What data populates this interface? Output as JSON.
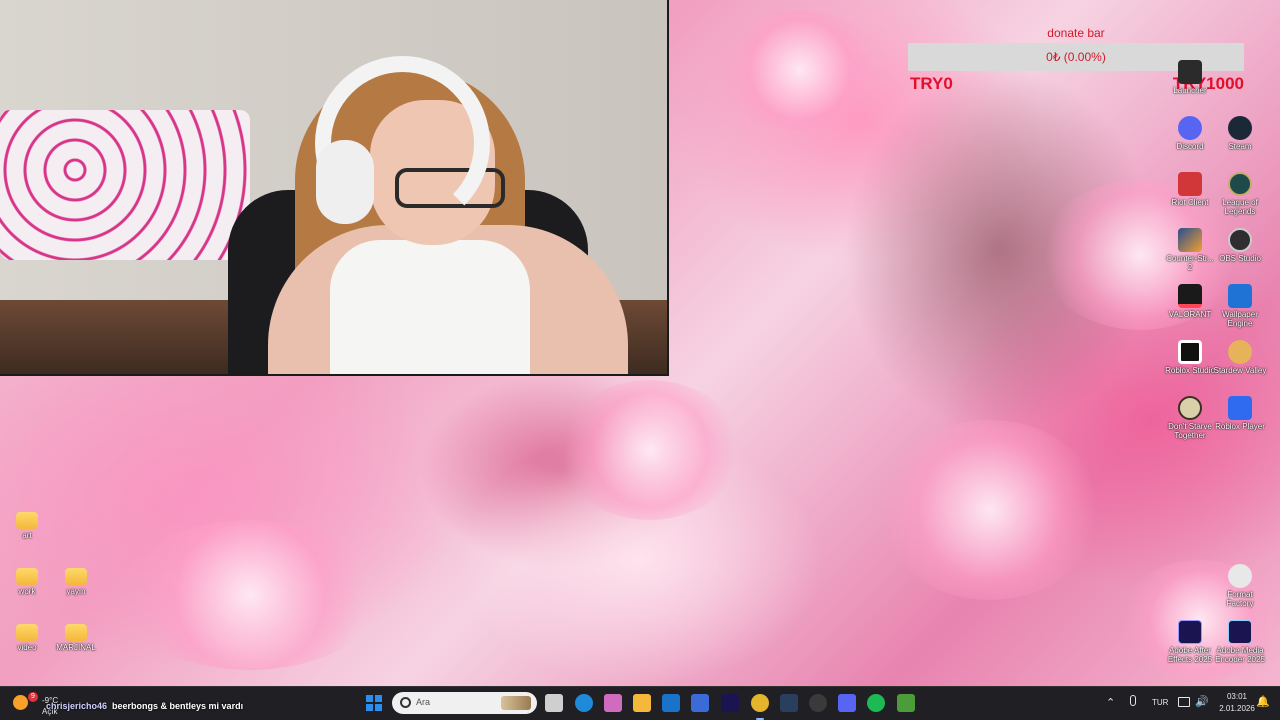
{
  "donate_bar": {
    "title": "donate bar",
    "value_text": "0₺ (0.00%)",
    "progress_fraction": 0.0,
    "min_label": "TRY0",
    "max_label": "TRY1000",
    "accent_color": "#d11a2a"
  },
  "desktop_left": {
    "items": [
      {
        "label": "art",
        "icon": "folder-icon"
      },
      {
        "label": "work",
        "icon": "folder-icon"
      },
      {
        "label": "yayın",
        "icon": "folder-icon"
      },
      {
        "label": "video",
        "icon": "folder-icon"
      },
      {
        "label": "MARJINAL",
        "icon": "folder-icon"
      }
    ]
  },
  "desktop_right": {
    "items": [
      {
        "label": "Launcher",
        "icon": "launcher-icon"
      },
      {
        "label": "Discord",
        "icon": "discord-icon"
      },
      {
        "label": "Steam",
        "icon": "steam-icon"
      },
      {
        "label": "Riot Client",
        "icon": "riot-client-icon"
      },
      {
        "label": "League of Legends",
        "icon": "league-of-legends-icon"
      },
      {
        "label": "Counter-Str... 2",
        "icon": "counter-strike-icon"
      },
      {
        "label": "OBS Studio",
        "icon": "obs-studio-icon"
      },
      {
        "label": "VALORANT",
        "icon": "valorant-icon"
      },
      {
        "label": "Wallpaper Engine",
        "icon": "wallpaper-engine-icon"
      },
      {
        "label": "Roblox Studio",
        "icon": "roblox-studio-icon"
      },
      {
        "label": "Stardew Valley",
        "icon": "stardew-valley-icon"
      },
      {
        "label": "Don't Starve Together",
        "icon": "dont-starve-icon"
      },
      {
        "label": "Roblox Player",
        "icon": "roblox-player-icon"
      },
      {
        "label": "Format Factory",
        "icon": "format-factory-icon"
      },
      {
        "label": "Adobe After Effects 2025",
        "icon": "after-effects-icon"
      },
      {
        "label": "Adobe Media Encoder 2025",
        "icon": "media-encoder-icon"
      }
    ]
  },
  "taskbar": {
    "weather": {
      "temp": "-9°C",
      "desc": "Açık",
      "badge": "9"
    },
    "chat": {
      "user": "chrisjericho46",
      "message": "beerbongs & bentleys mi vardı"
    },
    "search": {
      "placeholder": "Ara"
    },
    "apps": [
      {
        "name": "task-view-icon",
        "color": "#cfcfcf"
      },
      {
        "name": "edge-icon",
        "color": "#1f8ad8"
      },
      {
        "name": "copilot-icon",
        "color": "#d06cc0"
      },
      {
        "name": "file-explorer-icon",
        "color": "#f4b83b"
      },
      {
        "name": "outlook-icon",
        "color": "#1a73c8"
      },
      {
        "name": "store-icon",
        "color": "#3b6bd6"
      },
      {
        "name": "after-effects-icon",
        "color": "#1a1450"
      },
      {
        "name": "chrome-icon",
        "color": "#e4b42a"
      },
      {
        "name": "steam-icon",
        "color": "#2a3f5e"
      },
      {
        "name": "obs-icon",
        "color": "#3a3a3a"
      },
      {
        "name": "discord-icon",
        "color": "#5865f2"
      },
      {
        "name": "spotify-icon",
        "color": "#1db954"
      },
      {
        "name": "minecraft-icon",
        "color": "#4c9c3b"
      }
    ],
    "tray": {
      "language": "TUR",
      "time": "03:01",
      "date": "2.01.2026"
    }
  }
}
